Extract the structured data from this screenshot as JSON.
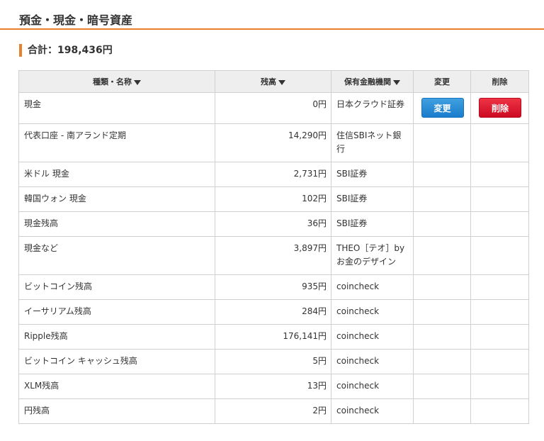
{
  "section": {
    "title": "預金・現金・暗号資産"
  },
  "total": {
    "label": "合計：198,436円"
  },
  "table": {
    "headers": {
      "name": "種類・名称",
      "balance": "残高",
      "institution": "保有金融機関",
      "edit": "変更",
      "delete": "削除"
    },
    "rows": [
      {
        "name": "現金",
        "balance": "0円",
        "institution": "日本クラウド証券",
        "edit_label": "変更",
        "delete_label": "削除"
      },
      {
        "name": "代表口座 - 南アランド定期",
        "balance": "14,290円",
        "institution": "住信SBIネット銀行"
      },
      {
        "name": "米ドル 現金",
        "balance": "2,731円",
        "institution": "SBI証券"
      },
      {
        "name": "韓国ウォン 現金",
        "balance": "102円",
        "institution": "SBI証券"
      },
      {
        "name": "現金残高",
        "balance": "36円",
        "institution": "SBI証券"
      },
      {
        "name": "現金など",
        "balance": "3,897円",
        "institution": "THEO［テオ］by お金のデザイン"
      },
      {
        "name": "ビットコイン残高",
        "balance": "935円",
        "institution": "coincheck"
      },
      {
        "name": "イーサリアム残高",
        "balance": "284円",
        "institution": "coincheck"
      },
      {
        "name": "Ripple残高",
        "balance": "176,141円",
        "institution": "coincheck"
      },
      {
        "name": "ビットコイン キャッシュ残高",
        "balance": "5円",
        "institution": "coincheck"
      },
      {
        "name": "XLM残高",
        "balance": "13円",
        "institution": "coincheck"
      },
      {
        "name": "円残高",
        "balance": "2円",
        "institution": "coincheck"
      }
    ]
  },
  "colors": {
    "accent": "#e8812e",
    "edit_button": "#1a7ccc",
    "delete_button": "#cc0a22"
  },
  "icons": {
    "sort": "sort-down-triangle-icon"
  }
}
